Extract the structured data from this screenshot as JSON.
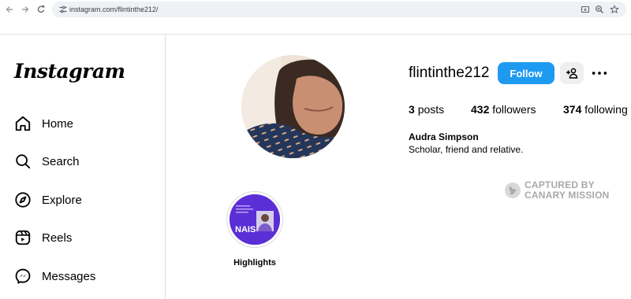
{
  "browser": {
    "url": "instagram.com/flintinthe212/"
  },
  "sidebar": {
    "logo": "Instagram",
    "items": [
      {
        "label": "Home",
        "icon": "home-icon"
      },
      {
        "label": "Search",
        "icon": "search-icon"
      },
      {
        "label": "Explore",
        "icon": "compass-icon"
      },
      {
        "label": "Reels",
        "icon": "reels-icon"
      },
      {
        "label": "Messages",
        "icon": "messenger-icon"
      }
    ]
  },
  "profile": {
    "username": "flintinthe212",
    "follow_label": "Follow",
    "posts_count": "3",
    "posts_label": "posts",
    "followers_count": "432",
    "followers_label": "followers",
    "following_count": "374",
    "following_label": "following",
    "full_name": "Audra Simpson",
    "bio": "Scholar, friend and relative."
  },
  "watermark": {
    "line1": "CAPTURED BY",
    "line2": "CANARY MISSION"
  },
  "highlights": [
    {
      "label": "Highlights",
      "cover_text": "NAIS"
    }
  ],
  "colors": {
    "follow_blue": "#1e9af1",
    "highlight_purple": "#5b2fd6",
    "watermark_gray": "#a7a9ab"
  }
}
